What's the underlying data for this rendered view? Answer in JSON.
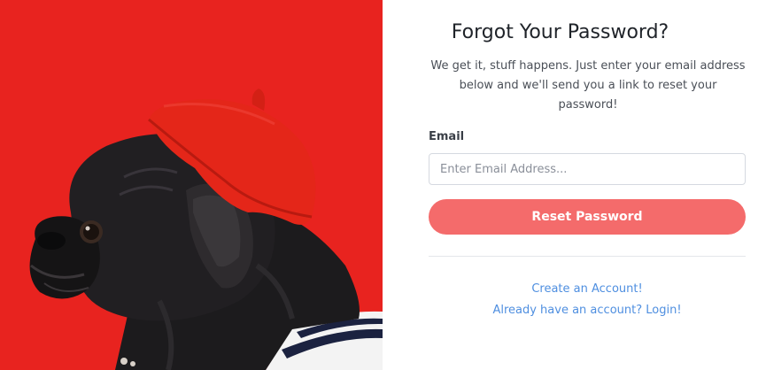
{
  "image": {
    "icon": "pug-in-red-beret-photo",
    "background_color": "#e8231f"
  },
  "form": {
    "title": "Forgot Your Password?",
    "subtitle": "We get it, stuff happens. Just enter your email address below and we'll send you a link to reset your password!",
    "email_label": "Email",
    "email_value": "",
    "email_placeholder": "Enter Email Address...",
    "submit_label": "Reset Password",
    "submit_color": "#f46b6b"
  },
  "links": {
    "create_account": "Create an Account!",
    "login": "Already have an account? Login!",
    "link_color": "#4f8fe0"
  }
}
